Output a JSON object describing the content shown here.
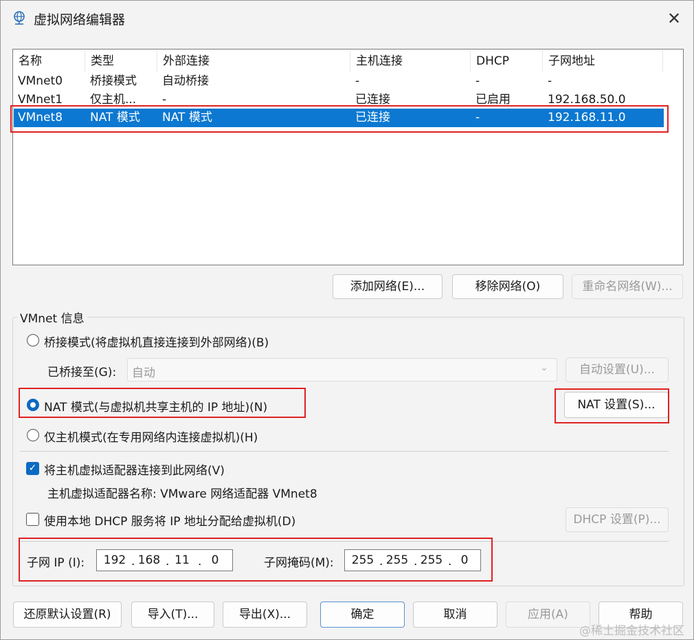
{
  "window": {
    "title": "虚拟网络编辑器",
    "icon": "network-globe-icon",
    "close_icon": "close-icon"
  },
  "network_table": {
    "columns": [
      "名称",
      "类型",
      "外部连接",
      "主机连接",
      "DHCP",
      "子网地址"
    ],
    "rows": [
      {
        "name": "VMnet0",
        "type": "桥接模式",
        "external": "自动桥接",
        "host": "-",
        "dhcp": "-",
        "subnet": "-"
      },
      {
        "name": "VMnet1",
        "type": "仅主机...",
        "external": "-",
        "host": "已连接",
        "dhcp": "已启用",
        "subnet": "192.168.50.0"
      },
      {
        "name": "VMnet8",
        "type": "NAT 模式",
        "external": "NAT 模式",
        "host": "已连接",
        "dhcp": "-",
        "subnet": "192.168.11.0"
      }
    ],
    "selected_row": "VMnet8"
  },
  "table_buttons": {
    "add": "添加网络(E)...",
    "remove": "移除网络(O)",
    "rename": "重命名网络(W)..."
  },
  "vmnet_info": {
    "group_label": "VMnet 信息",
    "bridged_radio": "桥接模式(将虚拟机直接连接到外部网络)(B)",
    "bridged_to_label": "已桥接至(G):",
    "bridged_to_value": "自动",
    "auto_settings_button": "自动设置(U)...",
    "nat_radio": "NAT 模式(与虚拟机共享主机的 IP 地址)(N)",
    "nat_settings_button": "NAT 设置(S)...",
    "hostonly_radio": "仅主机模式(在专用网络内连接虚拟机)(H)",
    "selected_mode": "nat",
    "connect_adapter_checkbox": "将主机虚拟适配器连接到此网络(V)",
    "connect_adapter_checked": true,
    "adapter_name_text": "主机虚拟适配器名称: VMware 网络适配器 VMnet8",
    "dhcp_checkbox": "使用本地 DHCP 服务将 IP 地址分配给虚拟机(D)",
    "dhcp_checked": false,
    "dhcp_settings_button": "DHCP 设置(P)...",
    "subnet_ip_label": "子网 IP (I):",
    "subnet_ip": [
      "192",
      "168",
      "11",
      "0"
    ],
    "subnet_mask_label": "子网掩码(M):",
    "subnet_mask": [
      "255",
      "255",
      "255",
      "0"
    ]
  },
  "footer_buttons": {
    "restore_defaults": "还原默认设置(R)",
    "import": "导入(T)...",
    "export": "导出(X)...",
    "ok": "确定",
    "cancel": "取消",
    "apply": "应用(A)",
    "help": "帮助"
  },
  "watermark": "@稀土掘金技术社区",
  "colors": {
    "selection": "#0c78d1",
    "highlight_box": "#e02020",
    "radio_checked": "#0c6ac1"
  }
}
